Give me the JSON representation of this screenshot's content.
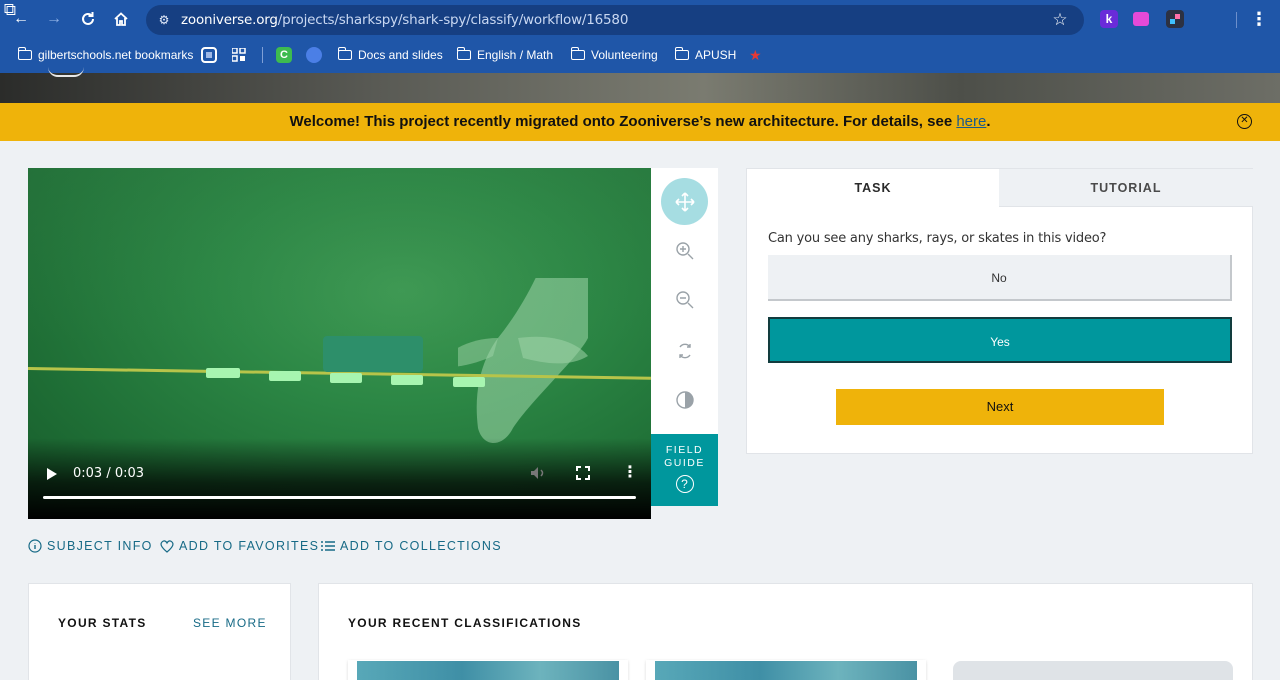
{
  "browser": {
    "url_host": "zooniverse.org",
    "url_path": "/projects/sharkspy/shark-spy/classify/workflow/16580",
    "extension_k": "k",
    "bookmarks": [
      {
        "label": "gilbertschools.net bookmarks",
        "icon": "managed-bookmarks-icon"
      },
      {
        "label": "Docs and slides",
        "icon": "folder-icon"
      },
      {
        "label": "English / Math",
        "icon": "folder-icon"
      },
      {
        "label": "Volunteering",
        "icon": "folder-icon"
      },
      {
        "label": "APUSH",
        "icon": "folder-icon"
      }
    ]
  },
  "banner": {
    "text": "Welcome! This project recently migrated onto Zooniverse’s new architecture. For details, see ",
    "link": "here",
    "suffix": "."
  },
  "video": {
    "time": "0:03 / 0:03",
    "progress": 1.0
  },
  "field_guide": {
    "line1": "FIELD",
    "line2": "GUIDE",
    "icon_glyph": "?"
  },
  "task_panel": {
    "tabs": [
      "TASK",
      "TUTORIAL"
    ],
    "question": "Can you see any sharks, rays, or skates in this video?",
    "answers": [
      {
        "label": "No",
        "selected": false
      },
      {
        "label": "Yes",
        "selected": true
      }
    ],
    "next_label": "Next"
  },
  "meta_actions": {
    "subject_info": "SUBJECT INFO",
    "favorites": "ADD TO FAVORITES",
    "collections": "ADD TO COLLECTIONS"
  },
  "stats": {
    "title": "YOUR STATS",
    "see_more": "SEE MORE"
  },
  "recent": {
    "title": "YOUR RECENT CLASSIFICATIONS"
  },
  "colors": {
    "chrome": "#1f56a8",
    "banner": "#efb30a",
    "teal": "#00979d",
    "link": "#176a86"
  }
}
